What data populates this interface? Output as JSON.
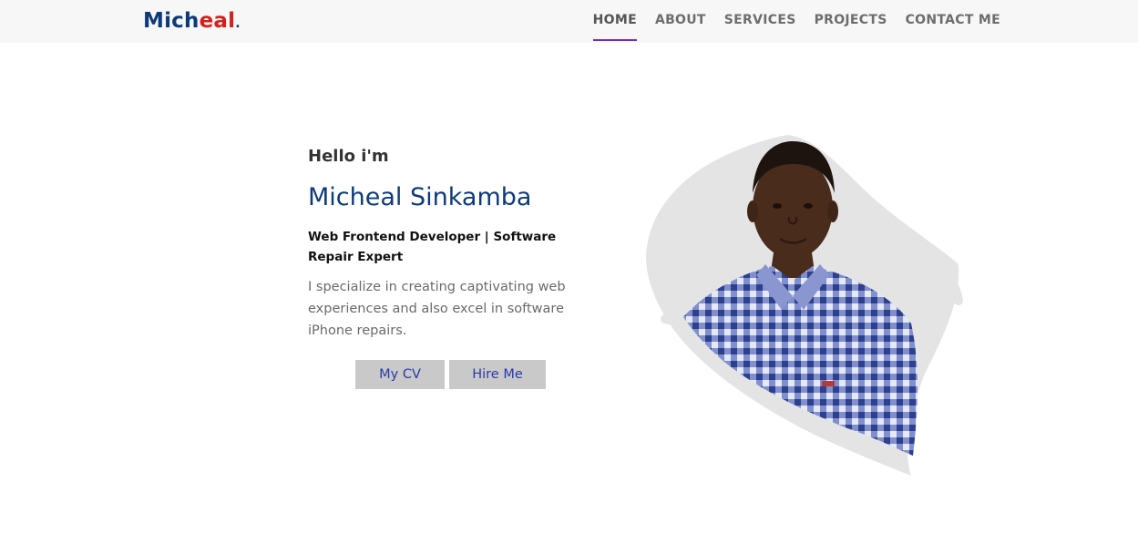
{
  "brand": {
    "part1": "Mich",
    "part2": "eal",
    "dot": ".",
    "primary_color": "#0d3b7a",
    "accent_color": "#d3211f"
  },
  "nav": {
    "items": [
      {
        "label": "HOME",
        "active": true
      },
      {
        "label": "ABOUT",
        "active": false
      },
      {
        "label": "SERVICES",
        "active": false
      },
      {
        "label": "PROJECTS",
        "active": false
      },
      {
        "label": "CONTACT ME",
        "active": false
      }
    ],
    "active_underline_color": "#6b2bd1"
  },
  "hero": {
    "greeting": "Hello i'm",
    "name": "Micheal Sinkamba",
    "role": "Web Frontend Developer | Software Repair Expert",
    "description": "I specialize in creating captivating web experiences and also excel in software iPhone repairs.",
    "buttons": {
      "cv": "My CV",
      "hire": "Hire Me"
    }
  },
  "portrait": {
    "icon": "profile-photo",
    "shirt_color": "#4a5fb0"
  }
}
